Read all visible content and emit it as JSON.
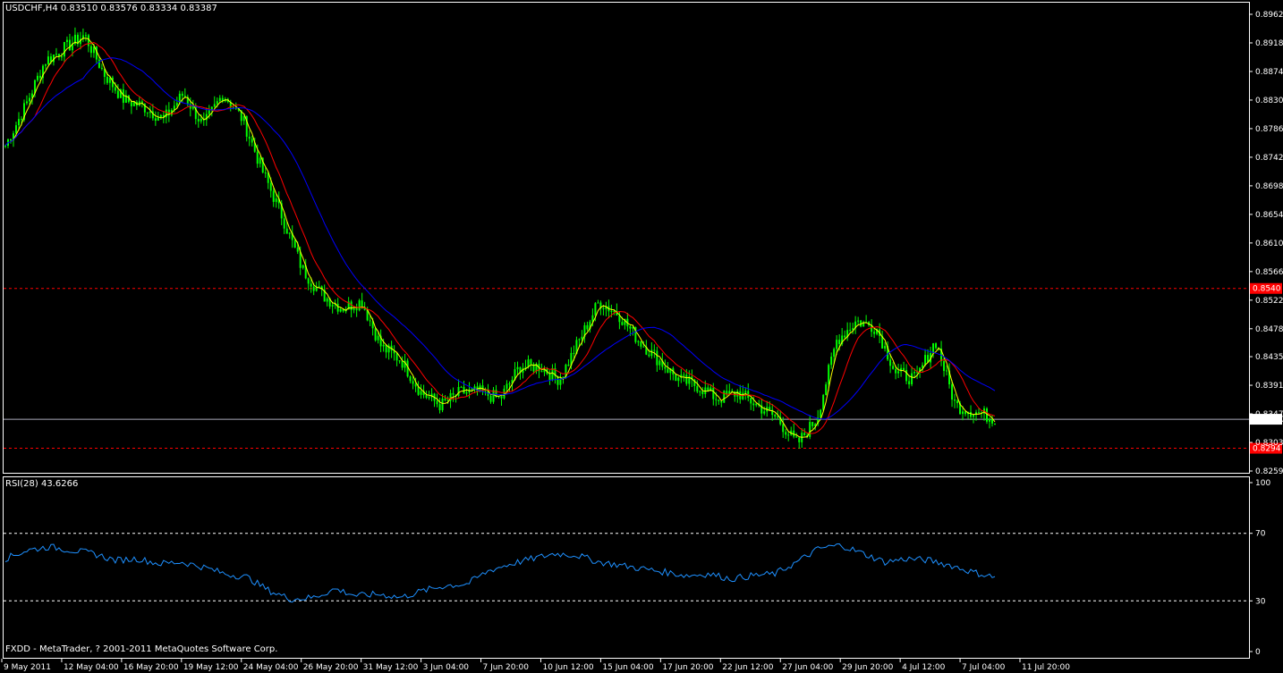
{
  "header": {
    "symbol_info": "USDCHF,H4  0.83510 0.83576 0.83334 0.83387"
  },
  "indicator": {
    "title": "RSI(28) 43.6266"
  },
  "footer": {
    "copyright": "FXDD - MetaTrader, ? 2001-2011 MetaQuotes Software Corp."
  },
  "colors": {
    "background": "#000000",
    "candles": "#00ff00",
    "ma_fast": "#ffff00",
    "ma_mid": "#ff0000",
    "ma_slow": "#0000ff",
    "rsi": "#1e90ff",
    "current_price_line": "#a9a9b9",
    "level_lines": "#ff0000",
    "price_tag_bg": "#ff0000"
  },
  "chart_data": [
    {
      "type": "candlestick",
      "symbol": "USDCHF",
      "timeframe": "H4",
      "ylim": [
        0.8259,
        0.8962
      ],
      "y_ticks": [
        "0.89620",
        "0.89180",
        "0.88740",
        "0.88300",
        "0.87860",
        "0.87420",
        "0.86980",
        "0.86540",
        "0.86100",
        "0.85660",
        "0.85220",
        "0.84780",
        "0.84350",
        "0.83910",
        "0.83470",
        "0.83030",
        "0.82590"
      ],
      "x_ticks": [
        "9 May 2011",
        "12 May 04:00",
        "16 May 20:00",
        "19 May 12:00",
        "24 May 04:00",
        "26 May 20:00",
        "31 May 12:00",
        "3 Jun 04:00",
        "7 Jun 20:00",
        "10 Jun 12:00",
        "15 Jun 04:00",
        "17 Jun 20:00",
        "22 Jun 12:00",
        "27 Jun 04:00",
        "29 Jun 20:00",
        "4 Jul 12:00",
        "7 Jul 04:00",
        "11 Jul 20:00"
      ],
      "close_anchors": [
        0.876,
        0.882,
        0.889,
        0.891,
        0.893,
        0.887,
        0.883,
        0.882,
        0.88,
        0.884,
        0.879,
        0.884,
        0.88,
        0.872,
        0.865,
        0.857,
        0.853,
        0.851,
        0.852,
        0.845,
        0.843,
        0.838,
        0.836,
        0.838,
        0.838,
        0.837,
        0.842,
        0.842,
        0.84,
        0.846,
        0.852,
        0.85,
        0.846,
        0.843,
        0.84,
        0.839,
        0.837,
        0.838,
        0.836,
        0.834,
        0.83,
        0.834,
        0.846,
        0.849,
        0.848,
        0.841,
        0.84,
        0.846,
        0.836,
        0.835,
        0.834
      ],
      "current_price": "0.83387",
      "levels": [
        {
          "label": "0.8540",
          "value": 0.854
        },
        {
          "label": "0.8294",
          "value": 0.8294
        }
      ],
      "series": [
        {
          "name": "",
          "kind": "ma_fast"
        },
        {
          "name": "",
          "kind": "ma_mid"
        },
        {
          "name": "",
          "kind": "ma_slow"
        }
      ]
    },
    {
      "type": "line",
      "title": "RSI(28) 43.6266",
      "ylim": [
        0,
        100
      ],
      "y_ticks": [
        "100",
        "70",
        "30",
        "0"
      ],
      "levels": [
        70,
        30
      ],
      "value_anchors": [
        55,
        60,
        62,
        60,
        58,
        54,
        55,
        52,
        53,
        50,
        46,
        44,
        36,
        31,
        32,
        37,
        33,
        34,
        32,
        36,
        39,
        40,
        48,
        52,
        55,
        58,
        57,
        53,
        51,
        49,
        47,
        45,
        46,
        43,
        45,
        46,
        53,
        61,
        63,
        58,
        53,
        55,
        54,
        51,
        47,
        44
      ]
    }
  ]
}
